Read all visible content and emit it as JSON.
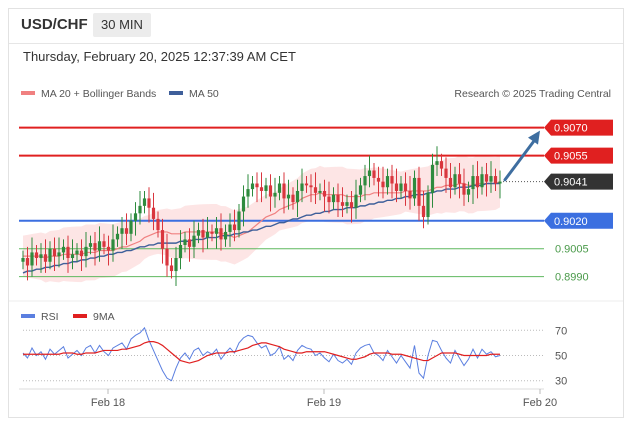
{
  "header": {
    "symbol": "USD/CHF",
    "timeframe": "30 MIN"
  },
  "datetime": "Thursday, February 20, 2025 12:37:39 AM CET",
  "legend": {
    "ma20": {
      "label": "MA 20 + Bollinger Bands",
      "color": "#f08080"
    },
    "ma50": {
      "label": "MA 50",
      "color": "#3e5f9a"
    },
    "rsi": {
      "label": "RSI",
      "color": "#5b7fe0"
    },
    "ma9": {
      "label": "9MA",
      "color": "#e02020"
    }
  },
  "watermark": "Research © 2025 Trading Central",
  "colors": {
    "resistance": "#e02020",
    "support": "#3b6fe0",
    "target": "#5fb85f",
    "bull": "#2e8b3e",
    "bear": "#d9363e",
    "arrow": "#3e6ea0",
    "band_fill": "#fde0e0"
  },
  "chart_data": [
    {
      "type": "candlestick",
      "symbol": "USD/CHF",
      "timeframe": "30 MIN",
      "ylim": [
        0.8978,
        0.908
      ],
      "x_tick_labels": [
        "Feb 18",
        "Feb 19",
        "Feb 20"
      ],
      "x_tick_index": [
        18,
        66,
        114
      ],
      "current_price": "0.9041",
      "levels": [
        {
          "label": "0.9070",
          "value": 0.907,
          "kind": "resistance"
        },
        {
          "label": "0.9055",
          "value": 0.9055,
          "kind": "resistance"
        },
        {
          "label": "0.9020",
          "value": 0.902,
          "kind": "support"
        },
        {
          "label": "0.9005",
          "value": 0.9005,
          "kind": "target"
        },
        {
          "label": "0.8990",
          "value": 0.899,
          "kind": "target"
        }
      ],
      "forecast_arrow": {
        "from": 0.9042,
        "to": 0.907
      },
      "closes": [
        0.9,
        0.8996,
        0.9003,
        0.9,
        0.9002,
        0.8998,
        0.9005,
        0.9001,
        0.9003,
        0.9006,
        0.9,
        0.9002,
        0.9004,
        0.9001,
        0.9006,
        0.9008,
        0.9004,
        0.9009,
        0.9006,
        0.9004,
        0.901,
        0.9013,
        0.9016,
        0.9013,
        0.902,
        0.9024,
        0.9028,
        0.9032,
        0.9027,
        0.9021,
        0.9015,
        0.9005,
        0.8996,
        0.8993,
        0.9,
        0.9007,
        0.901,
        0.9006,
        0.9012,
        0.9015,
        0.9011,
        0.9014,
        0.9013,
        0.9016,
        0.901,
        0.9014,
        0.9018,
        0.9015,
        0.9025,
        0.9033,
        0.9037,
        0.904,
        0.9038,
        0.9036,
        0.9039,
        0.9033,
        0.9035,
        0.904,
        0.9032,
        0.9034,
        0.903,
        0.9036,
        0.904,
        0.9039,
        0.9038,
        0.9035,
        0.9036,
        0.9033,
        0.903,
        0.9034,
        0.903,
        0.9028,
        0.903,
        0.9027,
        0.9034,
        0.9039,
        0.9044,
        0.9047,
        0.9043,
        0.9041,
        0.9038,
        0.9044,
        0.904,
        0.9036,
        0.904,
        0.9036,
        0.9032,
        0.9043,
        0.9028,
        0.9022,
        0.9035,
        0.905,
        0.9052,
        0.9048,
        0.9043,
        0.9038,
        0.9045,
        0.904,
        0.9034,
        0.9037,
        0.9044,
        0.9038,
        0.9045,
        0.9041,
        0.9044,
        0.904,
        0.9041
      ],
      "ma20": [
        0.9001,
        0.9001,
        0.9001,
        0.9001,
        0.9001,
        0.9,
        0.9001,
        0.9001,
        0.9001,
        0.9002,
        0.9002,
        0.9002,
        0.9002,
        0.9002,
        0.9003,
        0.9003,
        0.9003,
        0.9004,
        0.9004,
        0.9004,
        0.9004,
        0.9005,
        0.9006,
        0.9006,
        0.9007,
        0.9008,
        0.9009,
        0.9011,
        0.9012,
        0.9013,
        0.9014,
        0.9014,
        0.9014,
        0.9013,
        0.9013,
        0.9013,
        0.9014,
        0.9014,
        0.9014,
        0.9014,
        0.9014,
        0.9014,
        0.9014,
        0.9014,
        0.9013,
        0.9013,
        0.9012,
        0.9011,
        0.9012,
        0.9013,
        0.9014,
        0.9016,
        0.9018,
        0.902,
        0.9022,
        0.9023,
        0.9024,
        0.9026,
        0.9027,
        0.9028,
        0.9029,
        0.903,
        0.9032,
        0.9033,
        0.9034,
        0.9034,
        0.9035,
        0.9034,
        0.9034,
        0.9034,
        0.9034,
        0.9034,
        0.9033,
        0.9033,
        0.9033,
        0.9033,
        0.9034,
        0.9034,
        0.9035,
        0.9035,
        0.9035,
        0.9035,
        0.9035,
        0.9035,
        0.9035,
        0.9036,
        0.9036,
        0.9036,
        0.9036,
        0.9036,
        0.9036,
        0.9037,
        0.9038,
        0.9038,
        0.9039,
        0.9039,
        0.9039,
        0.904,
        0.904,
        0.9039,
        0.9039,
        0.904,
        0.904,
        0.904,
        0.904,
        0.904,
        0.9041
      ],
      "ma50": [
        0.8992,
        0.8993,
        0.8993,
        0.8994,
        0.8994,
        0.8995,
        0.8995,
        0.8996,
        0.8996,
        0.8997,
        0.8997,
        0.8998,
        0.8998,
        0.8999,
        0.8999,
        0.9,
        0.9,
        0.9001,
        0.9001,
        0.9002,
        0.9002,
        0.9003,
        0.9003,
        0.9004,
        0.9004,
        0.9005,
        0.9006,
        0.9006,
        0.9007,
        0.9007,
        0.9008,
        0.9008,
        0.9008,
        0.9008,
        0.9008,
        0.9009,
        0.9009,
        0.9009,
        0.901,
        0.901,
        0.901,
        0.9011,
        0.9011,
        0.9011,
        0.9012,
        0.9012,
        0.9012,
        0.9013,
        0.9013,
        0.9014,
        0.9014,
        0.9015,
        0.9015,
        0.9016,
        0.9017,
        0.9017,
        0.9018,
        0.9019,
        0.9019,
        0.902,
        0.9021,
        0.9021,
        0.9022,
        0.9023,
        0.9023,
        0.9024,
        0.9024,
        0.9025,
        0.9025,
        0.9026,
        0.9026,
        0.9026,
        0.9027,
        0.9027,
        0.9027,
        0.9028,
        0.9028,
        0.9029,
        0.9029,
        0.903,
        0.903,
        0.9031,
        0.9031,
        0.9032,
        0.9032,
        0.9033,
        0.9033,
        0.9034,
        0.9034,
        0.9034,
        0.9035,
        0.9035,
        0.9036,
        0.9036,
        0.9037,
        0.9037,
        0.9037,
        0.9038,
        0.9038,
        0.9038,
        0.9039,
        0.9039,
        0.9039,
        0.904,
        0.904,
        0.904,
        0.904
      ]
    },
    {
      "type": "line",
      "name": "RSI",
      "ylim": [
        25,
        75
      ],
      "y_ticks": [
        70,
        50,
        30
      ],
      "series": [
        {
          "name": "RSI",
          "values": [
            52,
            48,
            56,
            50,
            53,
            47,
            55,
            51,
            54,
            57,
            48,
            51,
            54,
            50,
            56,
            58,
            52,
            58,
            53,
            50,
            56,
            58,
            60,
            55,
            63,
            66,
            68,
            72,
            62,
            54,
            46,
            38,
            32,
            30,
            40,
            48,
            52,
            47,
            54,
            56,
            50,
            53,
            51,
            55,
            47,
            52,
            56,
            52,
            60,
            64,
            66,
            65,
            60,
            56,
            58,
            50,
            52,
            57,
            47,
            50,
            46,
            54,
            58,
            56,
            55,
            50,
            52,
            48,
            45,
            51,
            46,
            44,
            47,
            43,
            52,
            56,
            58,
            59,
            52,
            50,
            46,
            54,
            49,
            44,
            50,
            45,
            40,
            58,
            36,
            32,
            50,
            62,
            61,
            54,
            48,
            44,
            54,
            48,
            42,
            47,
            55,
            48,
            55,
            51,
            53,
            49,
            50
          ]
        },
        {
          "name": "9MA",
          "values": [
            51,
            51,
            51,
            51,
            51,
            51,
            51,
            51,
            51,
            52,
            52,
            52,
            51,
            51,
            52,
            52,
            52,
            53,
            54,
            54,
            54,
            54,
            55,
            55,
            56,
            57,
            58,
            60,
            61,
            61,
            60,
            58,
            55,
            52,
            49,
            46,
            45,
            44,
            45,
            46,
            48,
            50,
            51,
            52,
            52,
            52,
            53,
            53,
            54,
            55,
            56,
            58,
            59,
            60,
            60,
            59,
            58,
            57,
            55,
            54,
            53,
            52,
            52,
            53,
            53,
            53,
            53,
            53,
            52,
            51,
            50,
            49,
            48,
            47,
            47,
            48,
            49,
            51,
            52,
            52,
            52,
            52,
            51,
            51,
            51,
            50,
            49,
            48,
            47,
            46,
            46,
            48,
            50,
            52,
            52,
            52,
            52,
            51,
            50,
            50,
            50,
            50,
            50,
            50,
            51,
            51,
            51
          ]
        }
      ]
    }
  ]
}
